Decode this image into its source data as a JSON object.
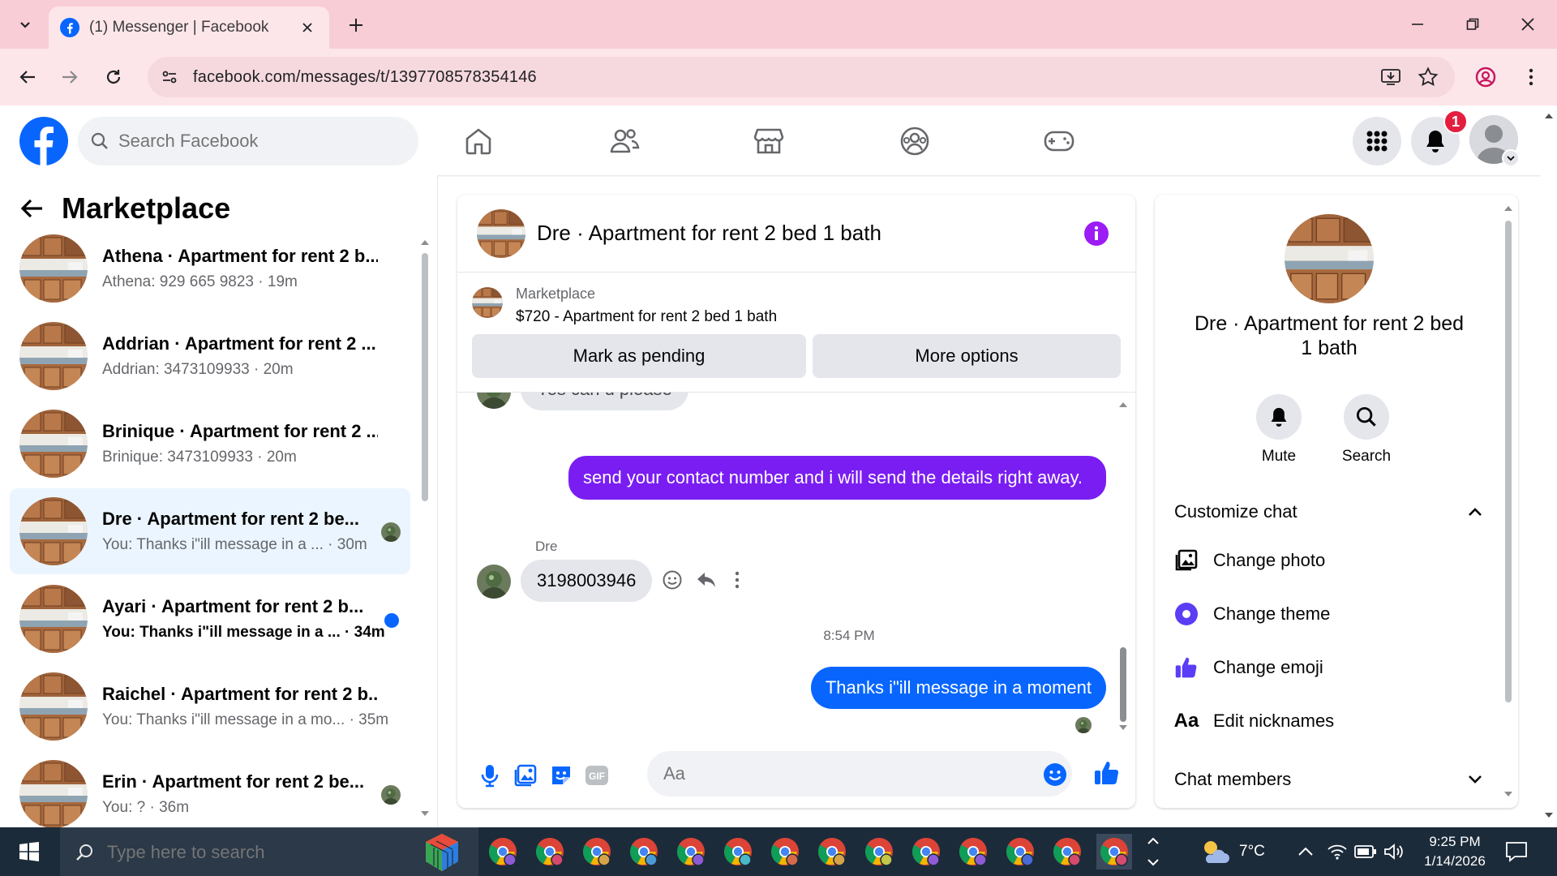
{
  "browser": {
    "tab_title": "(1) Messenger | Facebook",
    "url": "facebook.com/messages/t/1397708578354146"
  },
  "fb": {
    "search_placeholder": "Search Facebook",
    "notification_count": "1",
    "brand_color": "#0866ff"
  },
  "left": {
    "title": "Marketplace",
    "conversations": [
      {
        "title": "Athena · Apartment for rent 2 b...",
        "sub": "Athena: 929 665 9823 · 19m"
      },
      {
        "title": "Addrian · Apartment for rent 2 ...",
        "sub": "Addrian: 3473109933 · 20m"
      },
      {
        "title": "Brinique · Apartment for rent 2 ...",
        "sub": "Brinique: 3473109933 · 20m"
      },
      {
        "title": "Dre · Apartment for rent 2 be...",
        "sub": "You: Thanks i\"ill message in a ... · 30m"
      },
      {
        "title": "Ayari · Apartment for rent 2 b...",
        "sub": "You: Thanks i\"ill message in a ... · 34m"
      },
      {
        "title": "Raichel · Apartment for rent 2 b...",
        "sub": "You: Thanks i\"ill message in a mo... · 35m"
      },
      {
        "title": "Erin · Apartment for rent 2 be...",
        "sub": "You: ? · 36m"
      }
    ]
  },
  "chat": {
    "title": "Dre · Apartment for rent 2 bed 1 bath",
    "marketplace_label": "Marketplace",
    "listing": "$720 - Apartment for rent 2 bed 1 bath",
    "mark_pending": "Mark as pending",
    "more_options": "More options",
    "partial_message": "Yes can u please",
    "out_message_1": "send your contact number and i will send the details right away.",
    "sender_name": "Dre",
    "in_message": "3198003946",
    "timestamp": "8:54 PM",
    "out_message_2": "Thanks i\"ill message in a moment",
    "input_placeholder": "Aa",
    "accent_color": "#7a1df2"
  },
  "right": {
    "name": "Dre · Apartment for rent 2 bed 1 bath",
    "mute": "Mute",
    "search": "Search",
    "customize": "Customize chat",
    "change_photo": "Change photo",
    "change_theme": "Change theme",
    "change_emoji": "Change emoji",
    "edit_nicknames": "Edit nicknames",
    "aa_glyph": "Aa",
    "chat_members": "Chat members"
  },
  "taskbar": {
    "search_placeholder": "Type here to search",
    "temperature": "7°C",
    "time": "9:25 PM",
    "date": "1/14/2026"
  }
}
